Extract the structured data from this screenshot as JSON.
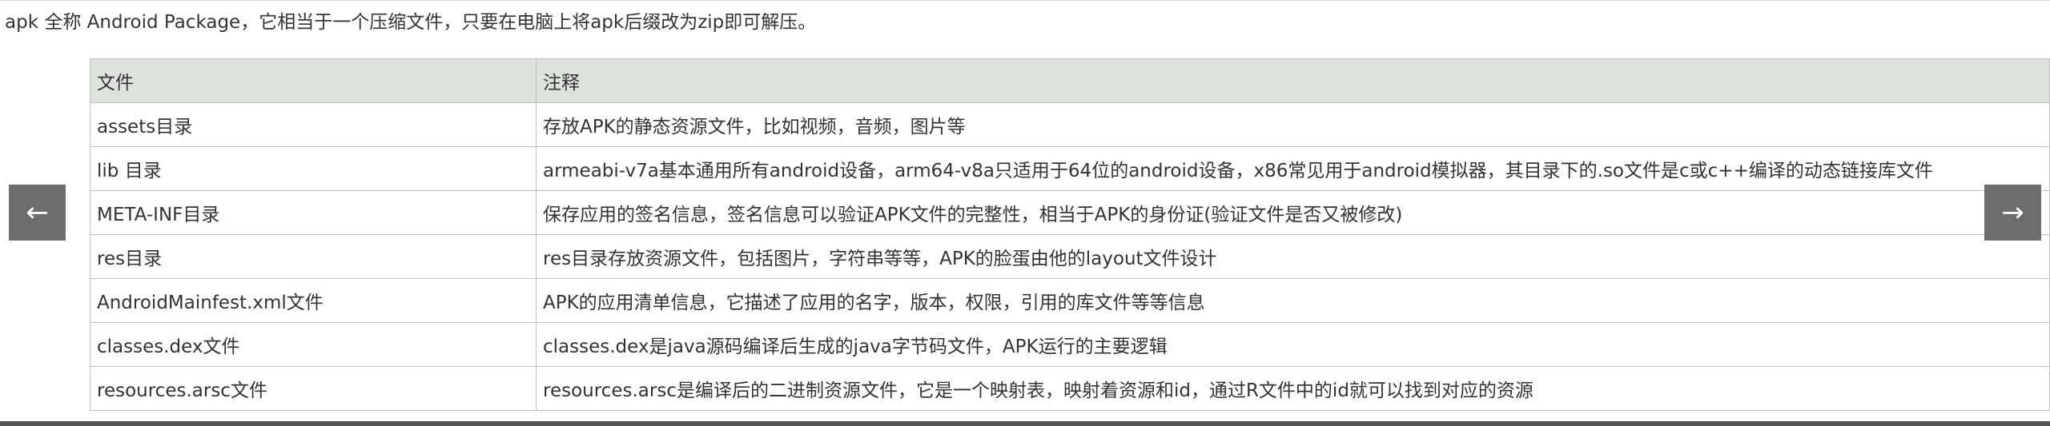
{
  "intro": "apk 全称 Android Package，它相当于一个压缩文件，只要在电脑上将apk后缀改为zip即可解压。",
  "table": {
    "headers": [
      "文件",
      "注释"
    ],
    "rows": [
      [
        "assets目录",
        "存放APK的静态资源文件，比如视频，音频，图片等"
      ],
      [
        "lib 目录",
        "armeabi-v7a基本通用所有android设备，arm64-v8a只适用于64位的android设备，x86常见用于android模拟器，其目录下的.so文件是c或c++编译的动态链接库文件"
      ],
      [
        "META-INF目录",
        "保存应用的签名信息，签名信息可以验证APK文件的完整性，相当于APK的身份证(验证文件是否又被修改)"
      ],
      [
        "res目录",
        "res目录存放资源文件，包括图片，字符串等等，APK的脸蛋由他的layout文件设计"
      ],
      [
        "AndroidMainfest.xml文件",
        "APK的应用清单信息，它描述了应用的名字，版本，权限，引用的库文件等等信息"
      ],
      [
        "classes.dex文件",
        "classes.dex是java源码编译后生成的java字节码文件，APK运行的主要逻辑"
      ],
      [
        "resources.arsc文件",
        "resources.arsc是编译后的二进制资源文件，它是一个映射表，映射着资源和id，通过R文件中的id就可以找到对应的资源"
      ]
    ]
  },
  "nav": {
    "prev": "←",
    "next": "→",
    "prev_icon": "arrow-left-icon",
    "next_icon": "arrow-right-icon"
  },
  "colors": {
    "header_bg": "#dde3dc",
    "border": "#bfbfbf",
    "nav_bg": "#6d6d6d",
    "text": "#333333"
  }
}
